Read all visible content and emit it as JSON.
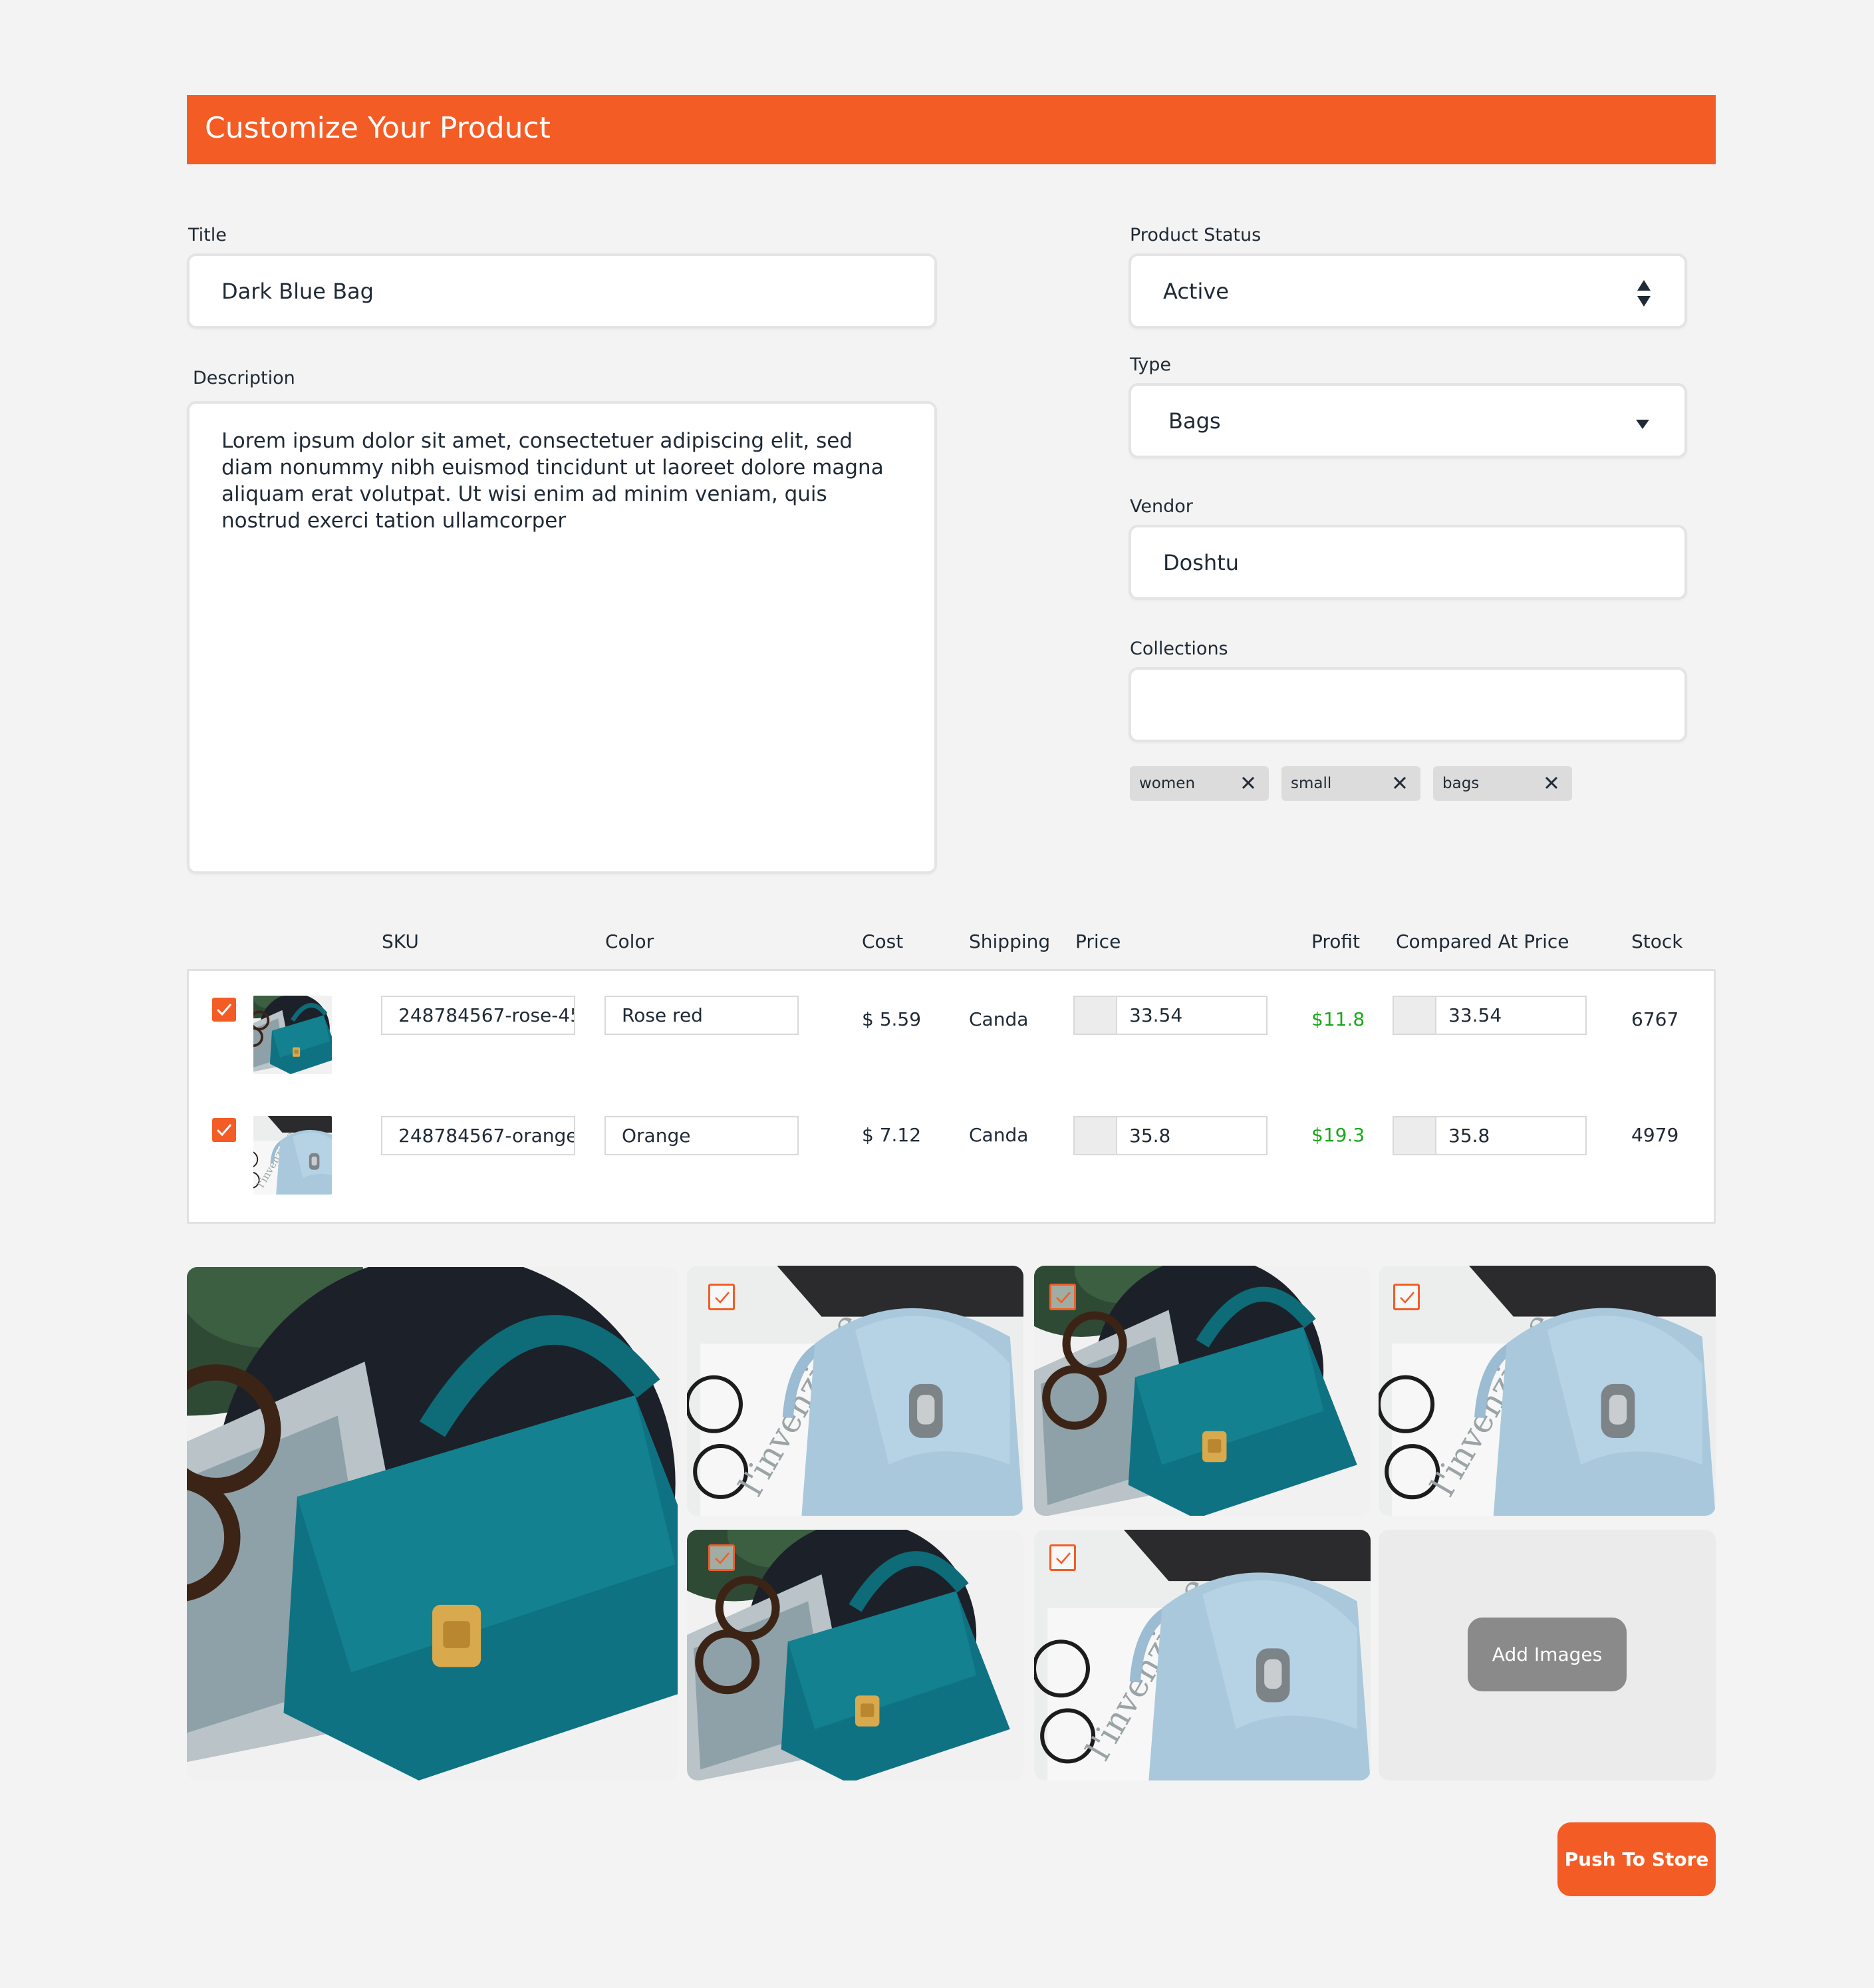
{
  "header": {
    "title": "Customize Your Product"
  },
  "form": {
    "title_label": "Title",
    "title_value": "Dark Blue Bag",
    "description_label": "Description",
    "description_value": "Lorem ipsum dolor sit amet, consectetuer adipiscing elit, sed diam nonummy nibh euismod tincidunt ut laoreet dolore magna aliquam erat volutpat. Ut wisi enim ad minim veniam, quis nostrud exerci tation ullamcorper",
    "status_label": "Product Status",
    "status_value": "Active",
    "type_label": "Type",
    "type_value": "Bags",
    "vendor_label": "Vendor",
    "vendor_value": "Doshtu",
    "collections_label": "Collections",
    "collections_value": "",
    "tags": [
      "women",
      "small",
      "bags"
    ]
  },
  "table": {
    "headers": [
      "SKU",
      "Color",
      "Cost",
      "Shipping",
      "Price",
      "Profit",
      "Compared At Price",
      "Stock"
    ],
    "rows": [
      {
        "checked": true,
        "sku": "248784567-rose-45",
        "color": "Rose red",
        "cost": "$ 5.59",
        "shipping": "Canda",
        "price": "33.54",
        "profit": "$11.8",
        "compared_price": "33.54",
        "stock": "6767"
      },
      {
        "checked": true,
        "sku": "248784567-orange-",
        "color": "Orange",
        "cost": "$ 7.12",
        "shipping": "Canda",
        "price": "35.8",
        "profit": "$19.3",
        "compared_price": "35.8",
        "stock": "4979"
      }
    ]
  },
  "gallery": {
    "images": [
      {
        "name": "teal-bag-main",
        "checked": false
      },
      {
        "name": "blue-bag",
        "checked": true
      },
      {
        "name": "teal-bag",
        "checked": true
      },
      {
        "name": "blue-bag",
        "checked": true
      },
      {
        "name": "teal-bag",
        "checked": true
      },
      {
        "name": "blue-bag",
        "checked": true
      }
    ],
    "add_images_label": "Add Images"
  },
  "actions": {
    "push_label": "Push To Store"
  },
  "colors": {
    "accent": "#f45c25",
    "profit": "#1aa81a",
    "background": "#f3f3f3",
    "add_button": "#8a8a8a"
  }
}
